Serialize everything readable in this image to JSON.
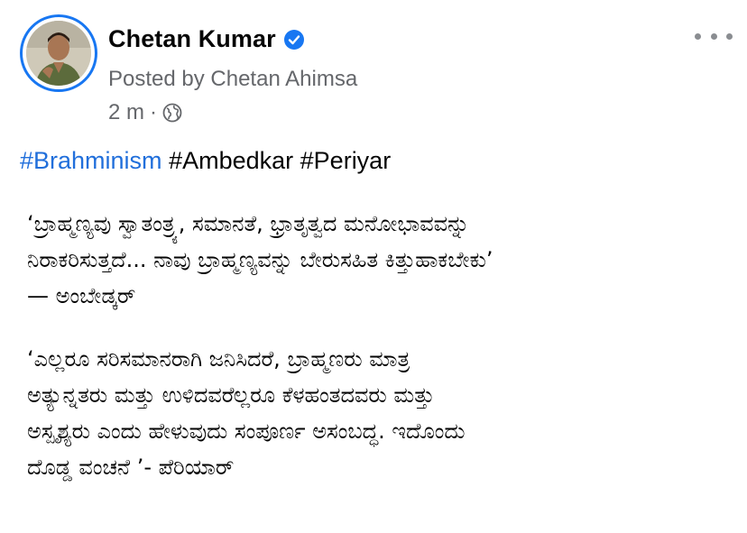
{
  "post": {
    "author_name": "Chetan Kumar",
    "posted_by": "Posted by Chetan Ahimsa",
    "time": "2 m",
    "separator": "·",
    "icons": {
      "verified": "verified-badge-icon",
      "audience": "globe-icon",
      "more": "more-options-icon"
    },
    "colors": {
      "accent": "#1877f2",
      "hashtag": "#216fdb",
      "muted": "#65676b"
    }
  },
  "content": {
    "hashtags": [
      "#Brahminism",
      "#Ambedkar",
      "#Periyar"
    ],
    "quote1": [
      "‘ಬ್ರಾಹ್ಮಣ್ಯವು ಸ್ವಾತಂತ್ರ್ಯ, ಸಮಾನತೆ, ಭ್ರಾತೃತ್ವದ ಮನೋಭಾವವನ್ನು",
      "ನಿರಾಕರಿಸುತ್ತದೆ... ನಾವು ಬ್ರಾಹ್ಮಣ್ಯವನ್ನು ಬೇರುಸಹಿತ ಕಿತ್ತುಹಾಕಬೇಕು’",
      "— ಅಂಬೇಡ್ಕರ್"
    ],
    "quote2": [
      "‘ಎಲ್ಲರೂ ಸರಿಸಮಾನರಾಗಿ ಜನಿಸಿದರೆ, ಬ್ರಾಹ್ಮಣರು ಮಾತ್ರ",
      "ಅತ್ಯುನ್ನತರು ಮತ್ತು ಉಳಿದವರೆಲ್ಲರೂ ಕೆಳಹಂತದವರು ಮತ್ತು",
      "ಅಸ್ಪೃಶ್ಯರು ಎಂದು ಹೇಳುವುದು ಸಂಪೂರ್ಣ ಅಸಂಬದ್ಧ. ಇದೊಂದು",
      "ದೊಡ್ಡ ವಂಚನೆ ’- ಪೆರಿಯಾರ್"
    ]
  }
}
